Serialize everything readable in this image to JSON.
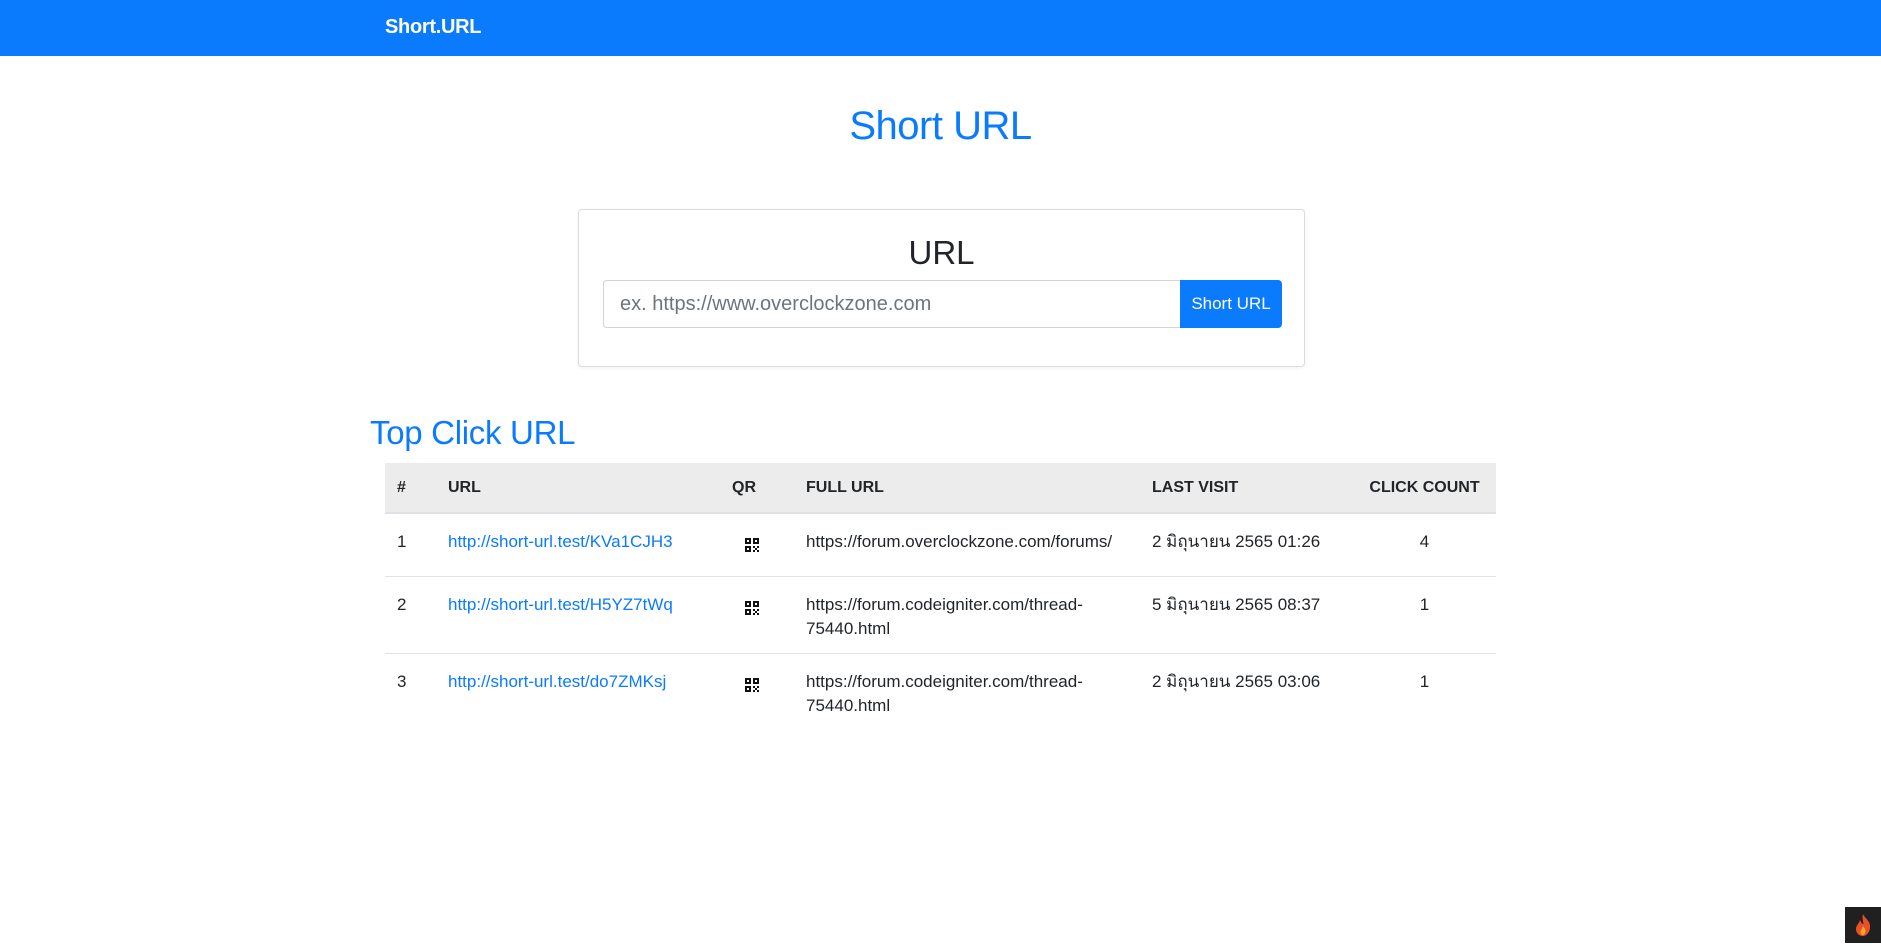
{
  "navbar": {
    "brand": "Short.URL"
  },
  "hero": {
    "title": "Short URL"
  },
  "form": {
    "title": "URL",
    "input_placeholder": "ex. https://www.overclockzone.com",
    "input_value": "",
    "button_label": "Short URL"
  },
  "top_clicks": {
    "title": "Top Click URL",
    "columns": [
      "#",
      "URL",
      "QR",
      "FULL URL",
      "LAST VISIT",
      "CLICK COUNT"
    ],
    "rows": [
      {
        "num": "1",
        "short_url": "http://short-url.test/KVa1CJH3",
        "full_url": "https://forum.overclockzone.com/forums/",
        "last_visit": "2 มิถุนายน 2565 01:26",
        "click_count": "4"
      },
      {
        "num": "2",
        "short_url": "http://short-url.test/H5YZ7tWq",
        "full_url": "https://forum.codeigniter.com/thread-75440.html",
        "last_visit": "5 มิถุนายน 2565 08:37",
        "click_count": "1"
      },
      {
        "num": "3",
        "short_url": "http://short-url.test/do7ZMKsj",
        "full_url": "https://forum.codeigniter.com/thread-75440.html",
        "last_visit": "2 มิถุนายน 2565 03:06",
        "click_count": "1"
      }
    ]
  },
  "icons": {
    "qr": "qrcode-icon",
    "debug_toolbar": "flame-icon"
  },
  "colors": {
    "primary": "#0a7bfd",
    "table_header_bg": "#ececec"
  }
}
